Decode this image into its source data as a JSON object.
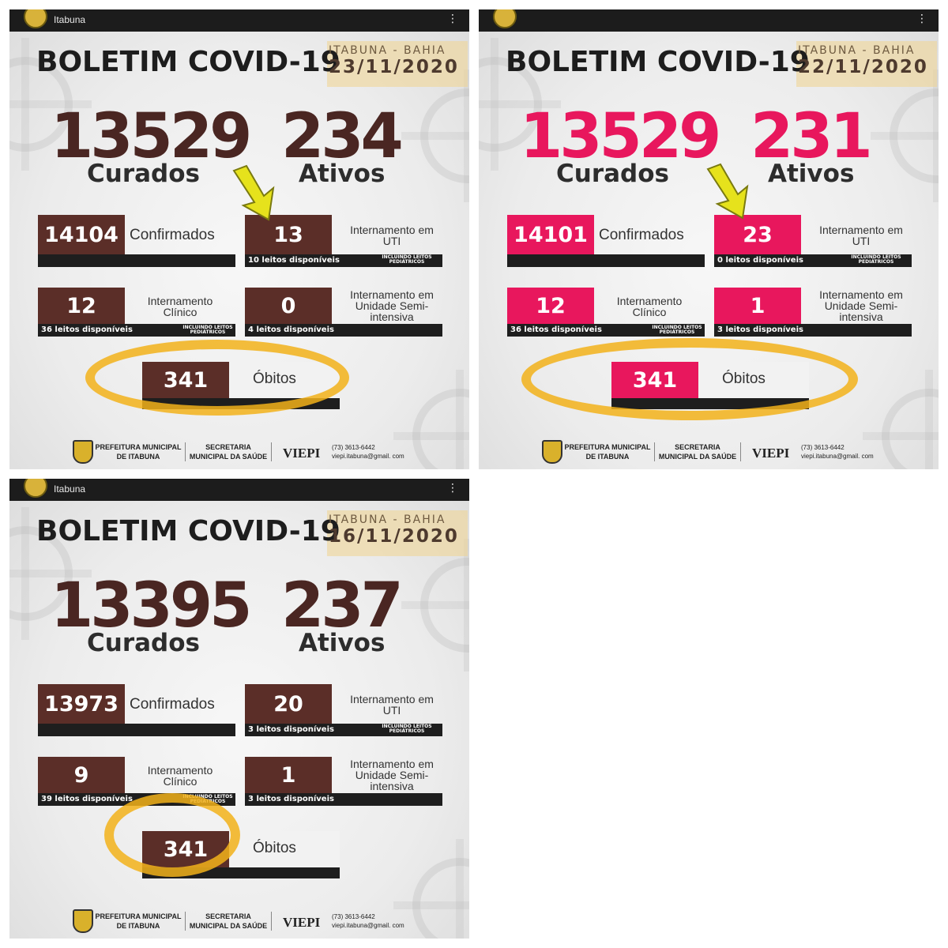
{
  "panels": [
    {
      "app_label": "Itabuna",
      "title": "BOLETIM COVID-19",
      "place": "ITABUNA - BAHIA",
      "date": "23/11/2020",
      "curados": "13529",
      "curados_label": "Curados",
      "ativos": "234",
      "ativos_label": "Ativos",
      "confirmados": "14104",
      "confirmados_label": "Confirmados",
      "uti": "13",
      "uti_label": "Internamento em UTI",
      "uti_beds": "10 leitos disponíveis",
      "uti_note": "INCLUINDO LEITOS PEDIÁTRICOS",
      "clinico": "12",
      "clinico_label": "Internamento Clínico",
      "clinico_beds": "36 leitos disponíveis",
      "clinico_note": "INCLUINDO LEITOS PEDIÁTRICOS",
      "semi": "0",
      "semi_label": "Internamento em Unidade Semi-intensiva",
      "semi_beds": "4 leitos disponíveis",
      "obitos": "341",
      "obitos_label": "Óbitos",
      "accent": "#5b2e28",
      "big_color": "#4a2622",
      "footer": {
        "prefeitura": "PREFEITURA MUNICIPAL DE ITABUNA",
        "secretaria": "SECRETARIA MUNICIPAL DA SAÚDE",
        "viepi": "VIEPI",
        "phone": "(73) 3613-6442",
        "email": "viepi.itabuna@gmail. com"
      }
    },
    {
      "app_label": "",
      "title": "BOLETIM COVID-19",
      "place": "ITABUNA - BAHIA",
      "date": "22/11/2020",
      "curados": "13529",
      "curados_label": "Curados",
      "ativos": "231",
      "ativos_label": "Ativos",
      "confirmados": "14101",
      "confirmados_label": "Confirmados",
      "uti": "23",
      "uti_label": "Internamento em UTI",
      "uti_beds": "0 leitos disponíveis",
      "uti_note": "INCLUINDO LEITOS PEDIÁTRICOS",
      "clinico": "12",
      "clinico_label": "Internamento Clínico",
      "clinico_beds": "36 leitos disponíveis",
      "clinico_note": "INCLUINDO LEITOS PEDIÁTRICOS",
      "semi": "1",
      "semi_label": "Internamento em Unidade Semi-intensiva",
      "semi_beds": "3 leitos disponíveis",
      "obitos": "341",
      "obitos_label": "Óbitos",
      "accent": "#e8175d",
      "big_color": "#e8175d",
      "footer": {
        "prefeitura": "PREFEITURA MUNICIPAL DE ITABUNA",
        "secretaria": "SECRETARIA MUNICIPAL DA SAÚDE",
        "viepi": "VIEPI",
        "phone": "(73) 3613-6442",
        "email": "viepi.itabuna@gmail. com"
      }
    },
    {
      "app_label": "Itabuna",
      "title": "BOLETIM COVID-19",
      "place": "ITABUNA - BAHIA",
      "date": "16/11/2020",
      "curados": "13395",
      "curados_label": "Curados",
      "ativos": "237",
      "ativos_label": "Ativos",
      "confirmados": "13973",
      "confirmados_label": "Confirmados",
      "uti": "20",
      "uti_label": "Internamento em UTI",
      "uti_beds": "3 leitos disponíveis",
      "uti_note": "INCLUINDO LEITOS PEDIÁTRICOS",
      "clinico": "9",
      "clinico_label": "Internamento Clínico",
      "clinico_beds": "39 leitos disponíveis",
      "clinico_note": "INCLUINDO LEITOS PEDIÁTRICOS",
      "semi": "1",
      "semi_label": "Internamento em Unidade Semi-intensiva",
      "semi_beds": "3 leitos disponíveis",
      "obitos": "341",
      "obitos_label": "Óbitos",
      "accent": "#5b2e28",
      "big_color": "#4a2622",
      "footer": {
        "prefeitura": "PREFEITURA MUNICIPAL DE ITABUNA",
        "secretaria": "SECRETARIA MUNICIPAL DA SAÚDE",
        "viepi": "VIEPI",
        "phone": "(73) 3613-6442",
        "email": "viepi.itabuna@gmail. com"
      }
    }
  ],
  "highlight_color": "#f2b21a",
  "arrow_color": "#e6e21c",
  "menu_icon": "kebab-menu-icon"
}
